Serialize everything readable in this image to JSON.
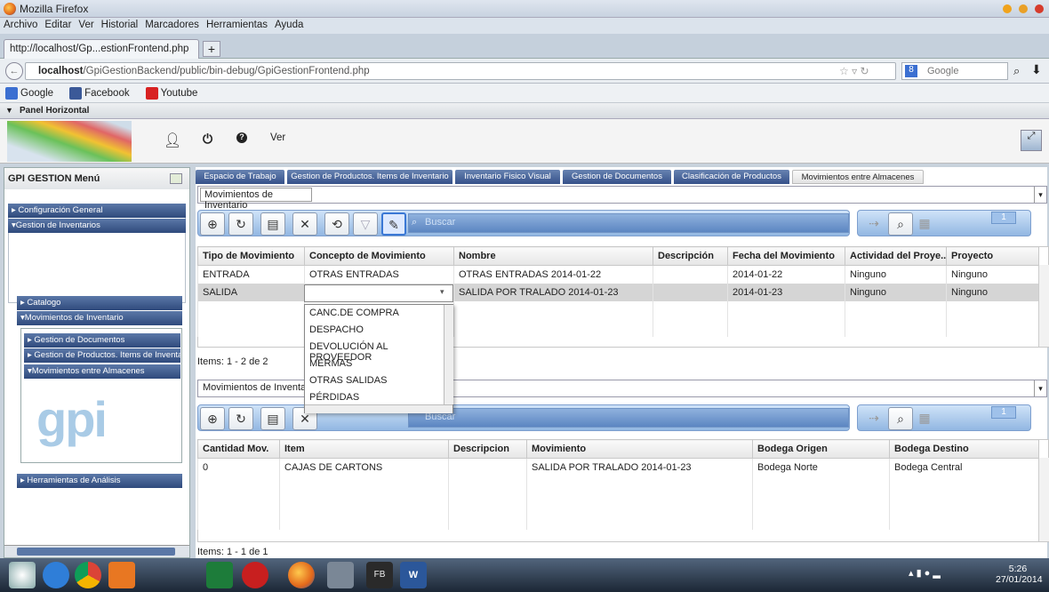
{
  "browser": {
    "window_title": "Mozilla Firefox",
    "menu": [
      "Archivo",
      "Editar",
      "Ver",
      "Historial",
      "Marcadores",
      "Herramientas",
      "Ayuda"
    ],
    "tab_title": "http://localhost/Gp...estionFrontend.php",
    "new_tab": "+",
    "url_host": "localhost",
    "url_path": "/GpiGestionBackend/public/bin-debug/GpiGestionFrontend.php",
    "search_placeholder": "Google",
    "bookmarks": [
      "Google",
      "Facebook",
      "Youtube"
    ],
    "panel": "Panel Horizontal"
  },
  "app": {
    "header_ver": "Ver",
    "sidebar": {
      "title": "GPI GESTION Menú",
      "sections": [
        "Configuración General",
        "Gestion de Inventarios",
        "Catalogo",
        "Movimientos de Inventario",
        "Herramientas de Análisis"
      ],
      "sub_items": [
        "Gestion de Documentos",
        "Gestion de Productos. Items de Inventario",
        "Movimientos entre Almacenes"
      ],
      "logo_text": "gpi"
    },
    "tabs": [
      "Espacio de Trabajo",
      "Gestion de Productos. Items de Inventario",
      "Inventario Fisico Visual",
      "Gestion de Documentos",
      "Clasificación de Productos",
      "Movimientos entre Almacenes"
    ],
    "top_combo": "Movimientos de Inventario",
    "search_placeholder": "Buscar",
    "page_badge": "1",
    "grid1": {
      "headers": [
        "Tipo de Movimiento",
        "Concepto de Movimiento",
        "Nombre",
        "Descripción",
        "Fecha del Movimiento",
        "Actividad del Proye...",
        "Proyecto"
      ],
      "rows": [
        [
          "ENTRADA",
          "OTRAS ENTRADAS",
          "OTRAS ENTRADAS 2014-01-22",
          "",
          "2014-01-22",
          "Ninguno",
          "Ninguno"
        ],
        [
          "SALIDA",
          "",
          "SALIDA POR TRALADO 2014-01-23",
          "",
          "2014-01-23",
          "Ninguno",
          "Ninguno"
        ]
      ],
      "footer": "Items: 1 - 2 de 2"
    },
    "dropdown_options": [
      "CANC.DE COMPRA",
      "DESPACHO",
      "DEVOLUCIÓN AL PROVEEDOR",
      "MERMAS",
      "OTRAS SALIDAS",
      "PÉRDIDAS"
    ],
    "bottom_combo": "Movimientos de Inventari",
    "grid2": {
      "headers": [
        "Cantidad Mov.",
        "Item",
        "Descripcion",
        "Movimiento",
        "Bodega Origen",
        "Bodega Destino"
      ],
      "rows": [
        [
          "0",
          "CAJAS DE CARTONS",
          "",
          "SALIDA POR TRALADO 2014-01-23",
          "Bodega Norte",
          "Bodega Central"
        ]
      ],
      "footer": "Items: 1 - 1 de 1"
    }
  },
  "taskbar": {
    "time": "5:26",
    "date": "27/01/2014",
    "fb_label": "FB"
  }
}
